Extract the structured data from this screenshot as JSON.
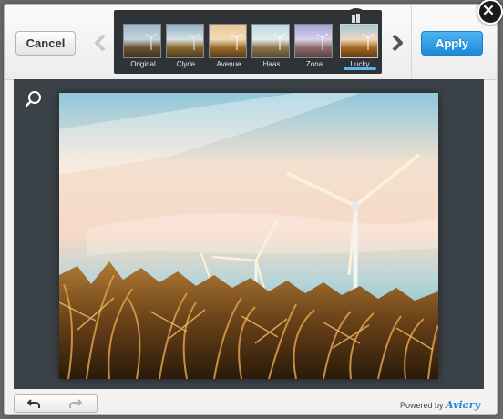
{
  "toolbar": {
    "cancel_label": "Cancel",
    "apply_label": "Apply"
  },
  "filters": [
    {
      "label": "Original",
      "selected": false
    },
    {
      "label": "Clyde",
      "selected": false
    },
    {
      "label": "Avenue",
      "selected": false
    },
    {
      "label": "Haas",
      "selected": false
    },
    {
      "label": "Zona",
      "selected": false
    },
    {
      "label": "Lucky",
      "selected": true
    }
  ],
  "footer": {
    "powered_prefix": "Powered by",
    "brand": "Aviary"
  },
  "icons": {
    "prev": "chevron-left-icon",
    "next": "chevron-right-icon",
    "close": "close-icon",
    "zoom": "magnifier-icon",
    "undo": "undo-icon",
    "redo": "redo-icon"
  },
  "colors": {
    "apply": "#1c8ad9",
    "strip": "#2e3338",
    "canvas": "#3b4247"
  }
}
